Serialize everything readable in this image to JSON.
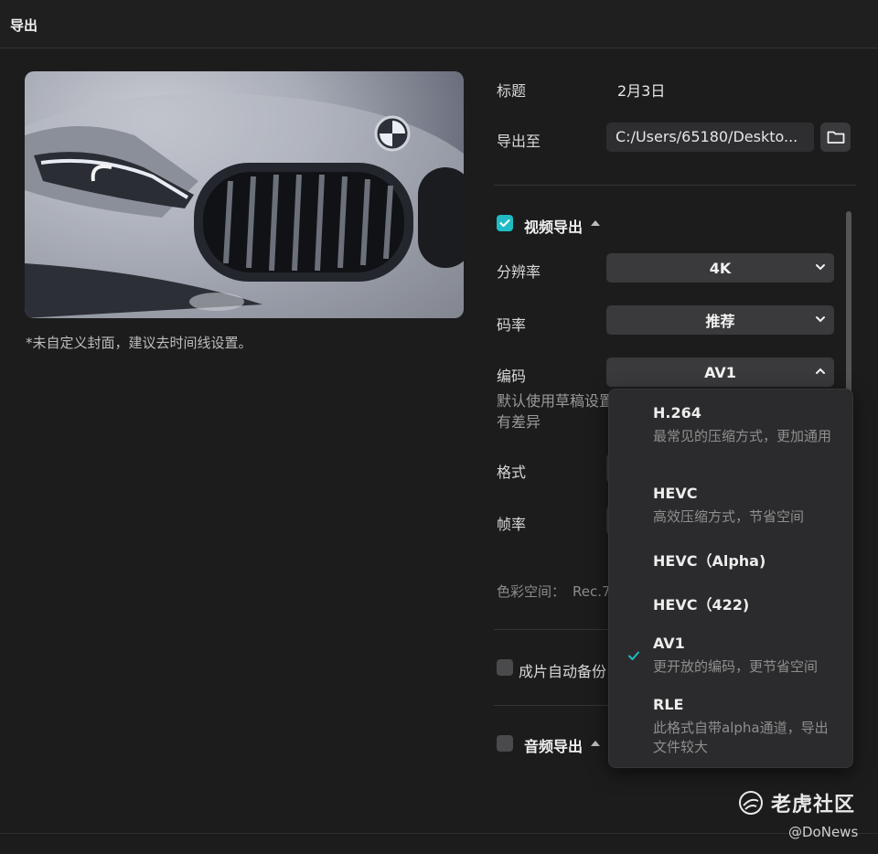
{
  "window": {
    "title": "导出"
  },
  "cover": {
    "note": "*未自定义封面，建议去时间线设置。"
  },
  "fields": {
    "title_label": "标题",
    "title_value": "2月3日",
    "export_to_label": "导出至",
    "export_path": "C:/Users/65180/Deskto..."
  },
  "video": {
    "section_title": "视频导出",
    "enabled": true,
    "resolution_label": "分辨率",
    "resolution_value": "4K",
    "bitrate_label": "码率",
    "bitrate_value": "推荐",
    "codec_label": "编码",
    "codec_value": "AV1",
    "codec_hint_line1": "默认使用草稿设置",
    "codec_hint_line2": "有差异",
    "format_label": "格式",
    "framerate_label": "帧率",
    "color_space_label": "色彩空间：",
    "color_space_value": "Rec.7"
  },
  "auto_backup": {
    "label": "成片自动备份",
    "enabled": false
  },
  "audio": {
    "section_title": "音频导出",
    "enabled": false
  },
  "codec_dropdown": {
    "selected": "AV1",
    "options": [
      {
        "name": "H.264",
        "desc": "最常见的压缩方式，更加通用"
      },
      {
        "name": "HEVC",
        "desc": "高效压缩方式，节省空间"
      },
      {
        "name": "HEVC（Alpha)"
      },
      {
        "name": "HEVC（422)"
      },
      {
        "name": "AV1",
        "desc": "更开放的编码，更节省空间"
      },
      {
        "name": "RLE",
        "desc": "此格式自带alpha通道，导出文件较大"
      }
    ]
  },
  "watermark": {
    "brand": "老虎社区",
    "handle": "@DoNews"
  },
  "colors": {
    "accent": "#20bcc6",
    "background": "#1c1c1d",
    "field": "#3a3a3d"
  }
}
